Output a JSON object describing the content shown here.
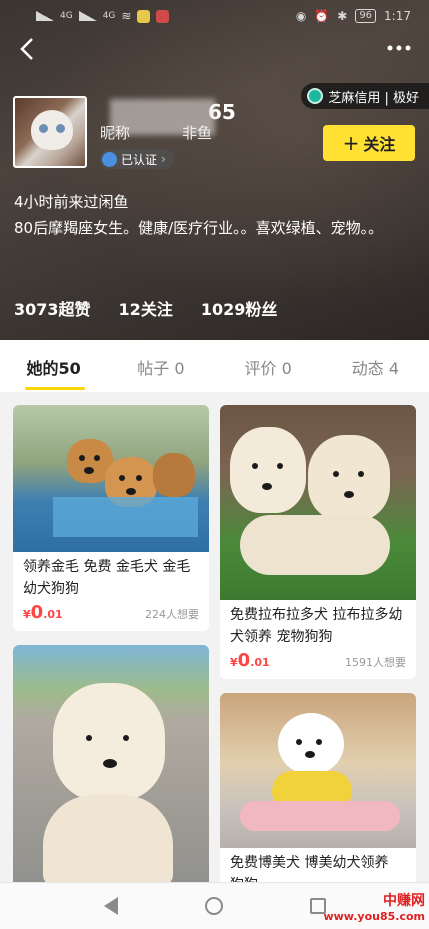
{
  "status_bar": {
    "signal_1": "4G",
    "signal_2": "4G",
    "battery": "96",
    "time": "1:17"
  },
  "header": {
    "back_icon": "chevron-left-icon",
    "more_icon": "more-dots-icon",
    "credit": "芝麻信用 | 极好",
    "name_suffix": "65",
    "nickname_label": "昵称",
    "nickname_suffix": "非鱼",
    "verified": "已认证",
    "follow": "关注",
    "last_seen": "4小时前来过闲鱼",
    "bio": "80后摩羯座女生。健康/医疗行业。。喜欢绿植、宠物。。",
    "stats": [
      "3073超赞",
      "12关注",
      "1029粉丝"
    ]
  },
  "tabs": [
    {
      "label": "她的50",
      "active": true
    },
    {
      "label": "帖子 0",
      "active": false
    },
    {
      "label": "评价 0",
      "active": false
    },
    {
      "label": "动态 4",
      "active": false
    }
  ],
  "items": [
    {
      "title": "领养金毛 免费 金毛犬 金毛幼犬狗狗",
      "currency": "¥",
      "price_int": "0",
      "price_dec": ".01",
      "wants": "224人想要"
    },
    {
      "title": "免费拉布拉多犬 拉布拉多幼犬领养 宠物狗狗",
      "currency": "¥",
      "price_int": "0",
      "price_dec": ".01",
      "wants": "1591人想要"
    },
    {
      "title": "",
      "currency": "",
      "price_int": "",
      "price_dec": "",
      "wants": ""
    },
    {
      "title": "免费博美犬 博美幼犬领养 狗狗",
      "currency": "",
      "price_int": "",
      "price_dec": "",
      "wants": ""
    }
  ],
  "watermark": {
    "top": "中赚网",
    "bottom": "www.you85.com"
  },
  "colors": {
    "accent": "#ffe033",
    "price": "#ff4444",
    "tab_underline": "#ffd400"
  }
}
